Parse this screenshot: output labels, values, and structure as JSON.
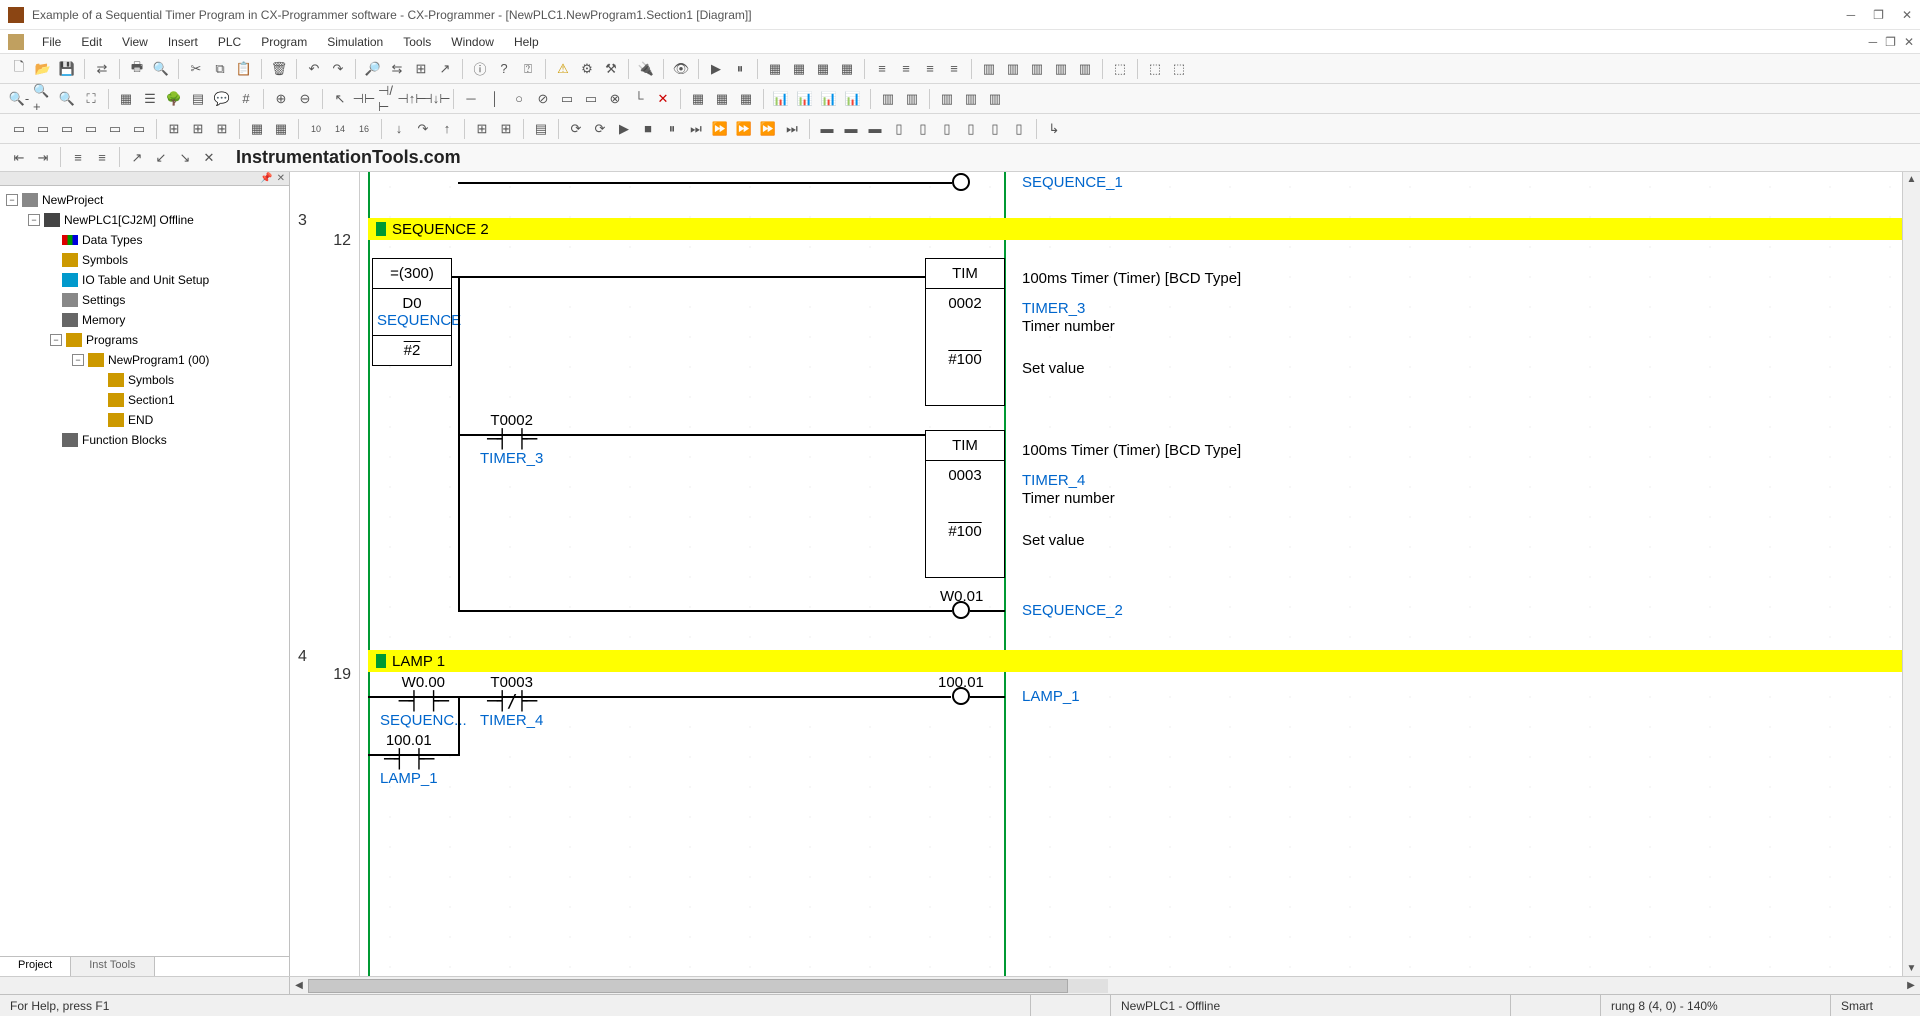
{
  "title": "Example of a Sequential Timer Program in CX-Programmer software - CX-Programmer - [NewPLC1.NewProgram1.Section1 [Diagram]]",
  "menu": [
    "File",
    "Edit",
    "View",
    "Insert",
    "PLC",
    "Program",
    "Simulation",
    "Tools",
    "Window",
    "Help"
  ],
  "brand": "InstrumentationTools.com",
  "tree": {
    "root": "NewProject",
    "plc": "NewPLC1[CJ2M] Offline",
    "items": [
      "Data Types",
      "Symbols",
      "IO Table and Unit Setup",
      "Settings",
      "Memory",
      "Programs"
    ],
    "program": "NewProgram1 (00)",
    "program_children": [
      "Symbols",
      "Section1",
      "END"
    ],
    "fb": "Function Blocks"
  },
  "tree_tabs": {
    "active": "Project",
    "other": "Inst Tools"
  },
  "ladder": {
    "gutter": {
      "n3": "3",
      "l12": "12",
      "n4": "4",
      "l19": "19"
    },
    "seq1_label": "SEQUENCE_1",
    "seq2_header": "SEQUENCE 2",
    "lamp1_header": "LAMP 1",
    "cmp_box": {
      "op": "=(300)",
      "d0": "D0",
      "dname": "SEQUENCE",
      "val": "#2"
    },
    "tim1": {
      "name": "TIM",
      "num": "0002",
      "sv": "#100"
    },
    "tim1_lbl": {
      "desc": "100ms Timer (Timer) [BCD Type]",
      "sym": "TIMER_3",
      "tn": "Timer number",
      "sv": "Set value"
    },
    "contact_t0002": {
      "addr": "T0002",
      "sym": "TIMER_3"
    },
    "tim2": {
      "name": "TIM",
      "num": "0003",
      "sv": "#100"
    },
    "tim2_lbl": {
      "desc": "100ms Timer (Timer) [BCD Type]",
      "sym": "TIMER_4",
      "tn": "Timer number",
      "sv": "Set value"
    },
    "coil_w001": {
      "addr": "W0.01",
      "sym": "SEQUENCE_2"
    },
    "contact_w000": {
      "addr": "W0.00",
      "sym": "SEQUENC..."
    },
    "contact_t0003": {
      "addr": "T0003",
      "sym": "TIMER_4"
    },
    "coil_10001": {
      "addr": "100.01",
      "sym": "LAMP_1"
    },
    "contact_10001": {
      "addr": "100.01",
      "sym": "LAMP_1"
    }
  },
  "status": {
    "help": "For Help, press F1",
    "plc": "NewPLC1 - Offline",
    "rung": "rung 8 (4, 0)  - 140%",
    "mode": "Smart"
  }
}
